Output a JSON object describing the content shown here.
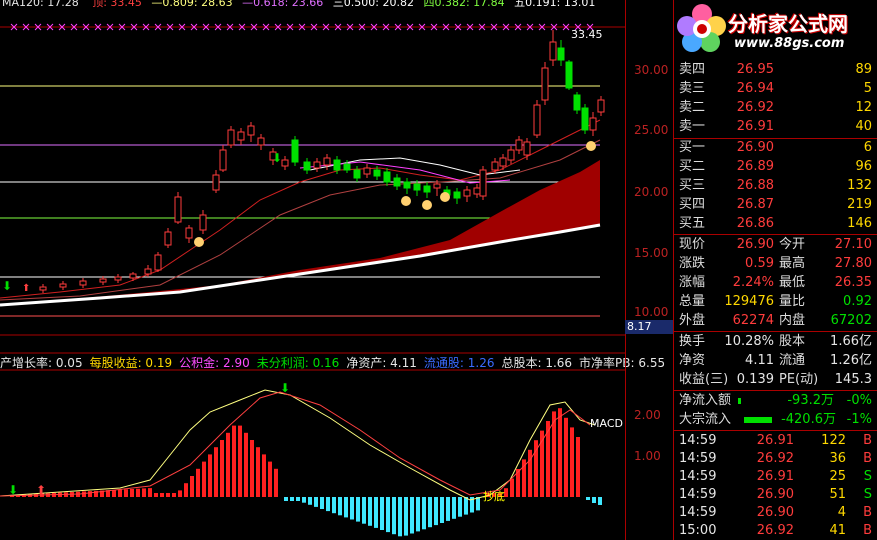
{
  "top_info": {
    "ma_label": "MA120: 17.28",
    "hi_label": "顶: 33.45",
    "fib1": "—0.809: 28.63",
    "fib2": "—0.618: 23.66",
    "fib3": "三0.500: 20.82",
    "fib4": "四0.382: 17.84",
    "fib5": "五0.191: 13.01"
  },
  "chart": {
    "high_marker": "33.45",
    "axis_ticks": [
      "30.00",
      "25.00",
      "20.00",
      "15.00",
      "10.00"
    ],
    "side_value": "8.17",
    "macd_ticks": [
      "2.00",
      "1.00"
    ],
    "macd_label": "MACD",
    "bottom_signal": "抄底"
  },
  "fin_bar": {
    "items": [
      {
        "text": "产增长率: 0.05",
        "color": "#e6e6e6"
      },
      {
        "text": "每股收益: 0.19",
        "color": "#ffd800"
      },
      {
        "text": "公积金: 2.90",
        "color": "#ff4dff"
      },
      {
        "text": "未分利润: 0.16",
        "color": "#00e000"
      },
      {
        "text": "净资产: 4.11",
        "color": "#e6e6e6"
      },
      {
        "text": "流通股: 1.26",
        "color": "#3a6bff"
      },
      {
        "text": "总股本: 1.66",
        "color": "#e6e6e6"
      },
      {
        "text": "市净率PB: 6.55",
        "color": "#e6e6e6"
      }
    ]
  },
  "logo": {
    "title": "分析家公式网",
    "url": "www.88gs.com"
  },
  "order_book": {
    "asks": [
      {
        "label": "卖四",
        "price": "26.95",
        "vol": "89"
      },
      {
        "label": "卖三",
        "price": "26.94",
        "vol": "5"
      },
      {
        "label": "卖二",
        "price": "26.92",
        "vol": "12"
      },
      {
        "label": "卖一",
        "price": "26.91",
        "vol": "40"
      }
    ],
    "bids": [
      {
        "label": "买一",
        "price": "26.90",
        "vol": "6"
      },
      {
        "label": "买二",
        "price": "26.89",
        "vol": "96"
      },
      {
        "label": "买三",
        "price": "26.88",
        "vol": "132"
      },
      {
        "label": "买四",
        "price": "26.87",
        "vol": "219"
      },
      {
        "label": "买五",
        "price": "26.86",
        "vol": "146"
      }
    ]
  },
  "quote": {
    "rows": [
      {
        "l1": "现价",
        "v1": "26.90",
        "c1": "r",
        "l2": "今开",
        "v2": "27.10",
        "c2": "r"
      },
      {
        "l1": "涨跌",
        "v1": "0.59",
        "c1": "r",
        "l2": "最高",
        "v2": "27.80",
        "c2": "r"
      },
      {
        "l1": "涨幅",
        "v1": "2.24%",
        "c1": "r",
        "l2": "最低",
        "v2": "26.35",
        "c2": "r"
      },
      {
        "l1": "总量",
        "v1": "129476",
        "c1": "y",
        "l2": "量比",
        "v2": "0.92",
        "c2": "g"
      },
      {
        "l1": "外盘",
        "v1": "62274",
        "c1": "r",
        "l2": "内盘",
        "v2": "67202",
        "c2": "g"
      }
    ],
    "rows2": [
      {
        "l1": "换手",
        "v1": "10.28%",
        "c1": "w",
        "l2": "股本",
        "v2": "1.66亿",
        "c2": "w"
      },
      {
        "l1": "净资",
        "v1": "4.11",
        "c1": "w",
        "l2": "流通",
        "v2": "1.26亿",
        "c2": "w"
      },
      {
        "l1": "收益(三)",
        "v1": "0.139",
        "c1": "w",
        "l2": "PE(动)",
        "v2": "145.3",
        "c2": "w"
      }
    ]
  },
  "flow": {
    "net_label": "净流入额",
    "net_value": "-93.2万",
    "net_pct": "-0%",
    "block_label": "大宗流入",
    "block_value": "-420.6万",
    "block_pct": "-1%"
  },
  "ticks": [
    {
      "time": "14:59",
      "price": "26.91",
      "vol": "122",
      "side": "B"
    },
    {
      "time": "14:59",
      "price": "26.92",
      "vol": "36",
      "side": "B"
    },
    {
      "time": "14:59",
      "price": "26.91",
      "vol": "25",
      "side": "S"
    },
    {
      "time": "14:59",
      "price": "26.90",
      "vol": "51",
      "side": "S"
    },
    {
      "time": "14:59",
      "price": "26.90",
      "vol": "4",
      "side": "B"
    },
    {
      "time": "15:00",
      "price": "26.92",
      "vol": "41",
      "side": "B"
    }
  ],
  "colors": {
    "up": "#ff3c3c",
    "down": "#00e000",
    "band": "#a00000",
    "macd_neg": "#3cf"
  }
}
